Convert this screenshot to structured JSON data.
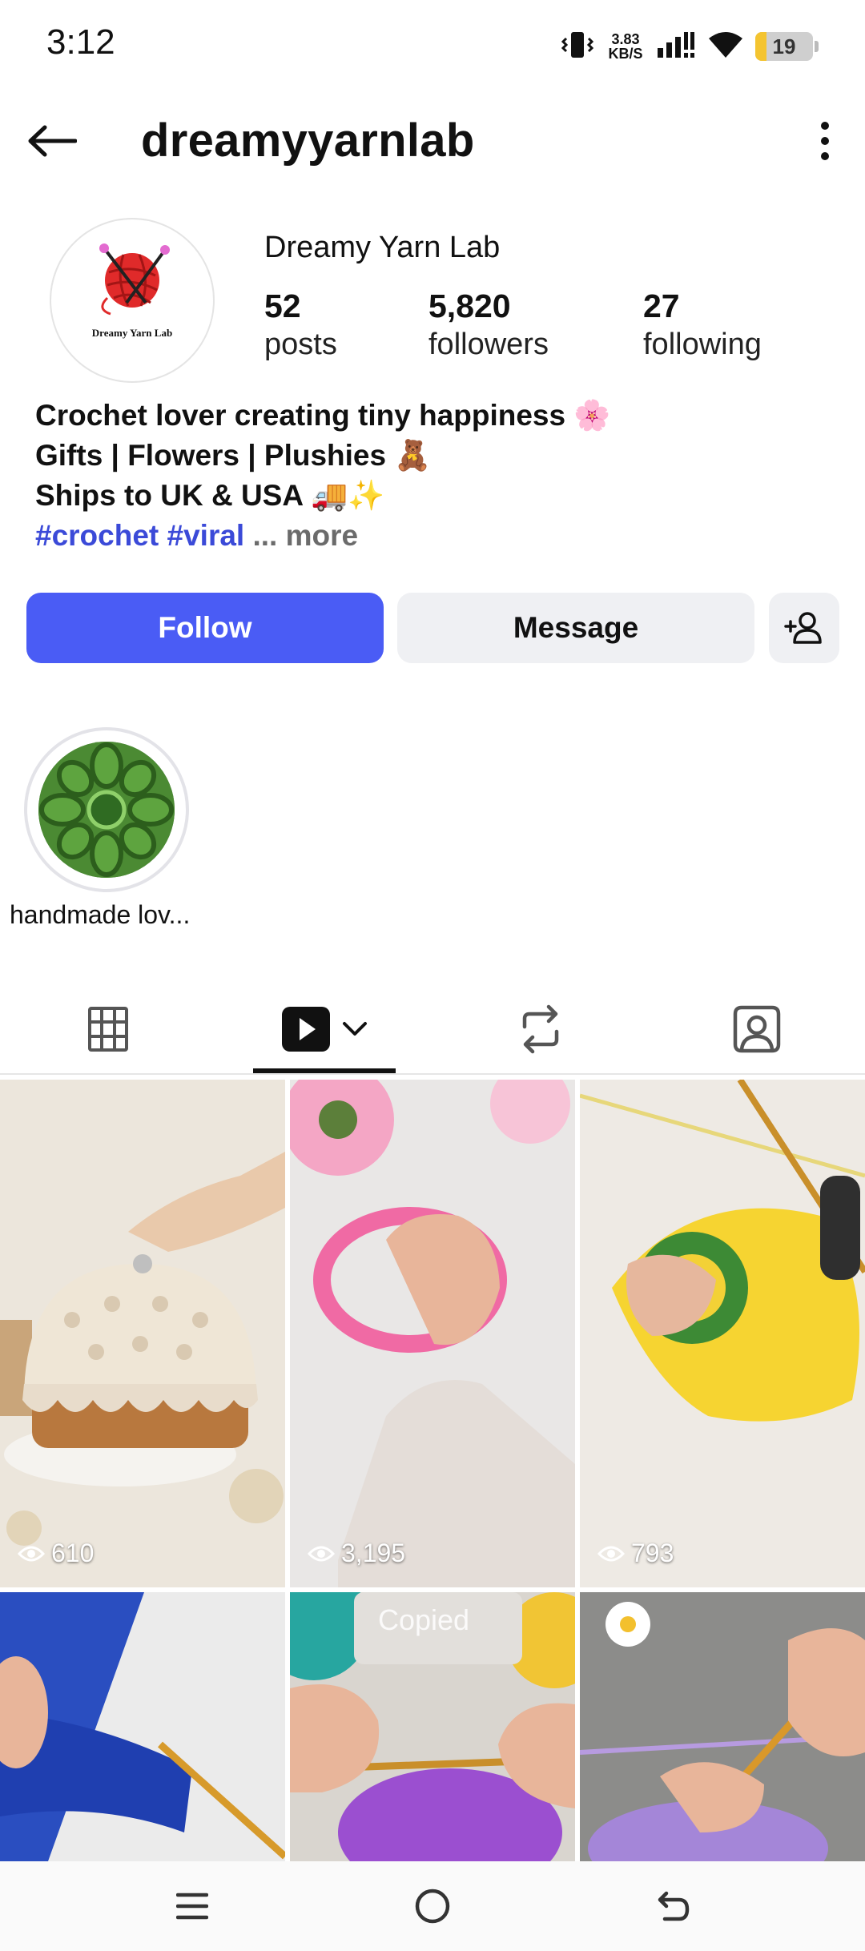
{
  "status_bar": {
    "time": "3:12",
    "speed_value": "3.83",
    "speed_unit": "KB/S",
    "battery_level": "19",
    "battery_fraction": 0.19,
    "icons": [
      "vibrate-icon",
      "signal-icon",
      "wifi-icon",
      "battery-icon"
    ]
  },
  "header": {
    "username": "dreamyyarnlab",
    "back_icon": "arrow-left-icon",
    "menu_icon": "more-vertical-icon"
  },
  "profile": {
    "display_name": "Dreamy Yarn Lab",
    "avatar_text": "Dreamy Yarn Lab",
    "stats": [
      {
        "value": "52",
        "label": "posts"
      },
      {
        "value": "5,820",
        "label": "followers"
      },
      {
        "value": "27",
        "label": "following"
      }
    ],
    "bio": {
      "line1": "Crochet lover creating tiny happiness 🌸",
      "line2": "Gifts | Flowers | Plushies 🧸",
      "line3": "Ships to UK & USA 🚚✨",
      "tags": "#crochet #viral",
      "more": " ... more"
    }
  },
  "actions": {
    "follow": "Follow",
    "message": "Message",
    "add_user_icon": "add-person-icon"
  },
  "highlights": [
    {
      "label": "handmade lov..."
    }
  ],
  "tabs": [
    {
      "name": "grid-icon"
    },
    {
      "name": "reels-icon",
      "active": true
    },
    {
      "name": "reposts-icon"
    },
    {
      "name": "tagged-icon"
    }
  ],
  "posts": [
    {
      "views": "610"
    },
    {
      "views": "3,195"
    },
    {
      "views": "793"
    },
    {
      "views": ""
    },
    {
      "views": ""
    },
    {
      "views": ""
    }
  ],
  "toast": "Copied",
  "colors": {
    "accent": "#4a5cf5",
    "hashtag": "#3b4ad8",
    "button_gray": "#eff0f3"
  },
  "navbar": [
    "menu-icon",
    "home-icon",
    "back-icon"
  ]
}
